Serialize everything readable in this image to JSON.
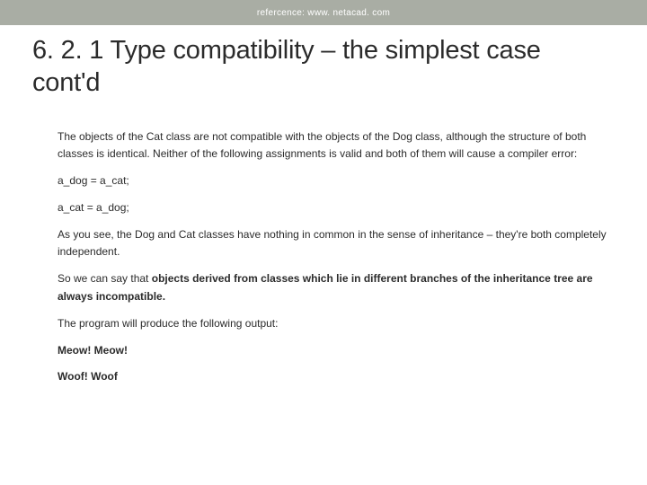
{
  "header": {
    "reference": "refercence: www. netacad. com"
  },
  "title": "6. 2. 1 Type compatibility – the simplest case cont'd",
  "paragraphs": {
    "p1": "The objects of the Cat class are not compatible with the objects of the Dog class, although the structure of both classes is identical. Neither of the following assignments is valid and both of them will cause a compiler error:",
    "code1": "a_dog = a_cat;",
    "code2": "a_cat = a_dog;",
    "p2": "As you see, the Dog and Cat classes have nothing in common in the sense of inheritance – they're both completely independent.",
    "p3_prefix": "So we can say that ",
    "p3_bold": "objects derived from classes which lie in different branches of the inheritance tree are always incompatible.",
    "p4": "The program will produce the following output:",
    "out1": "Meow! Meow!",
    "out2": "Woof! Woof"
  }
}
